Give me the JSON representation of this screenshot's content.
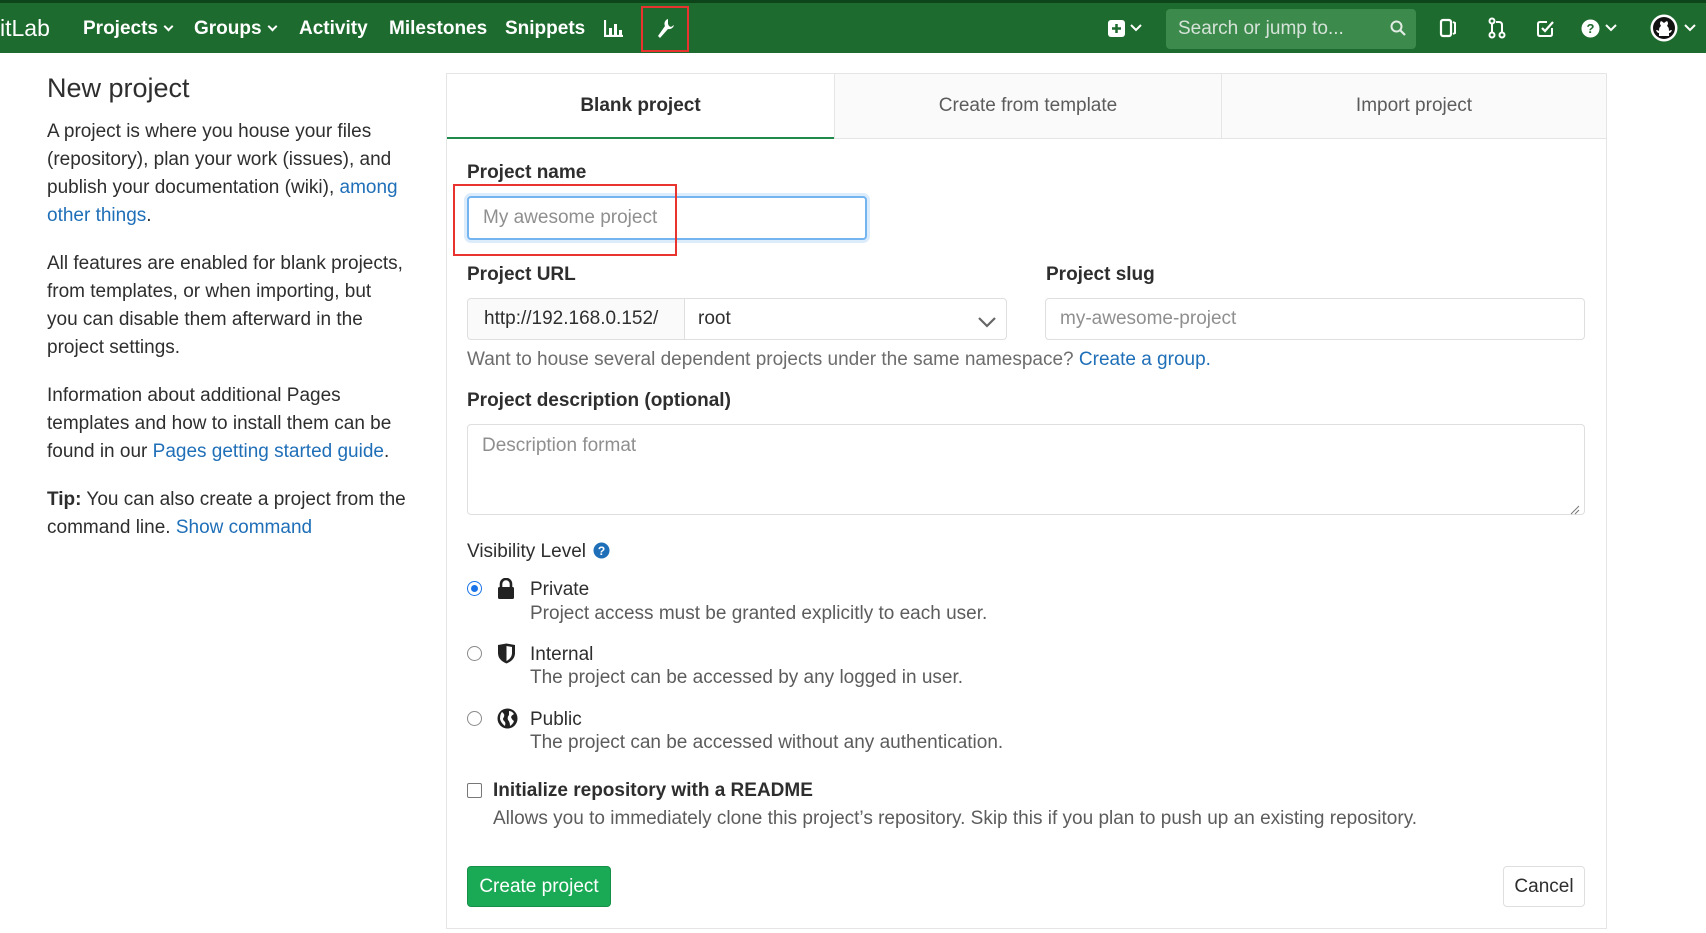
{
  "navbar": {
    "brand": "itLab",
    "items": [
      {
        "label": "Projects"
      },
      {
        "label": "Groups"
      },
      {
        "label": "Activity"
      },
      {
        "label": "Milestones"
      },
      {
        "label": "Snippets"
      }
    ],
    "search_placeholder": "Search or jump to..."
  },
  "sidebar": {
    "title": "New project",
    "para1_text": "A project is where you house your files (repository), plan your work (issues), and publish your documentation (wiki), ",
    "para1_link": "among other things",
    "para1_end": ".",
    "para2": "All features are enabled for blank projects, from templates, or when importing, but you can disable them afterward in the project settings.",
    "para3_text": "Information about additional Pages templates and how to install them can be found in our ",
    "para3_link": "Pages getting started guide",
    "para3_end": ".",
    "tip_label": "Tip:",
    "tip_text": " You can also create a project from the command line. ",
    "tip_link": "Show command"
  },
  "tabs": [
    {
      "label": "Blank project",
      "active": true
    },
    {
      "label": "Create from template",
      "active": false
    },
    {
      "label": "Import project",
      "active": false
    }
  ],
  "form": {
    "name_label": "Project name",
    "name_placeholder": "My awesome project",
    "url_label": "Project URL",
    "url_prefix": "http://192.168.0.152/",
    "namespace": "root",
    "slug_label": "Project slug",
    "slug_placeholder": "my-awesome-project",
    "group_help_text": "Want to house several dependent projects under the same namespace? ",
    "group_help_link": "Create a group.",
    "desc_label": "Project description (optional)",
    "desc_placeholder": "Description format",
    "visibility_label": "Visibility Level",
    "visibility": [
      {
        "title": "Private",
        "desc": "Project access must be granted explicitly to each user.",
        "icon": "lock-icon",
        "checked": true
      },
      {
        "title": "Internal",
        "desc": "The project can be accessed by any logged in user.",
        "icon": "shield-icon",
        "checked": false
      },
      {
        "title": "Public",
        "desc": "The project can be accessed without any authentication.",
        "icon": "globe-icon",
        "checked": false
      }
    ],
    "readme_label": "Initialize repository with a README",
    "readme_desc": "Allows you to immediately clone this project’s repository. Skip this if you plan to push up an existing repository.",
    "create_button": "Create project",
    "cancel_button": "Cancel"
  },
  "colors": {
    "navbar": "#1d6b2e",
    "link": "#1f6fb8",
    "create_button": "#1aaa55",
    "highlight": "#e8332f"
  }
}
